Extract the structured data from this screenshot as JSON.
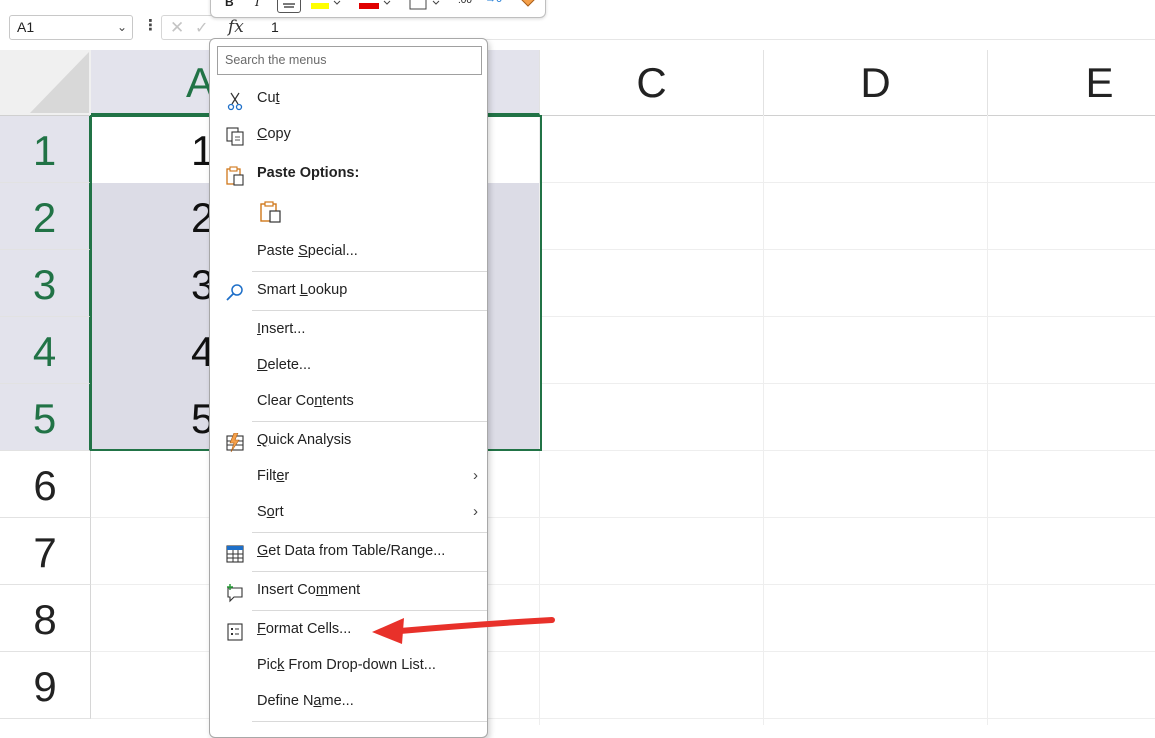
{
  "formula_bar": {
    "name_box": "A1",
    "formula_value": "1",
    "fx_label": "fx"
  },
  "columns": [
    "A",
    "C",
    "D",
    "E"
  ],
  "rows": [
    "1",
    "2",
    "3",
    "4",
    "5",
    "6",
    "7",
    "8",
    "9"
  ],
  "cells_col_a": [
    "1",
    "2",
    "3",
    "4",
    "5"
  ],
  "context_menu": {
    "search_placeholder": "Search the menus",
    "items": {
      "cut": {
        "pre": "Cu",
        "key": "t",
        "post": ""
      },
      "copy": {
        "pre": "",
        "key": "C",
        "post": "opy"
      },
      "paste_options": "Paste Options:",
      "paste_special": {
        "pre": "Paste ",
        "key": "S",
        "post": "pecial..."
      },
      "smart_lookup": {
        "pre": "Smart ",
        "key": "L",
        "post": "ookup"
      },
      "insert": {
        "pre": "",
        "key": "I",
        "post": "nsert..."
      },
      "delete": {
        "pre": "",
        "key": "D",
        "post": "elete..."
      },
      "clear_contents": {
        "pre": "Clear Co",
        "key": "n",
        "post": "tents"
      },
      "quick_analysis": {
        "pre": "",
        "key": "Q",
        "post": "uick Analysis"
      },
      "filter": {
        "pre": "Filt",
        "key": "e",
        "post": "r"
      },
      "sort": {
        "pre": "S",
        "key": "o",
        "post": "rt"
      },
      "get_data": {
        "pre": "",
        "key": "G",
        "post": "et Data from Table/Range..."
      },
      "insert_comment": {
        "pre": "Insert Co",
        "key": "m",
        "post": "ment"
      },
      "format_cells": {
        "pre": "",
        "key": "F",
        "post": "ormat Cells..."
      },
      "pick_list": {
        "pre": "Pic",
        "key": "k",
        "post": " From Drop-down List..."
      },
      "define_name": {
        "pre": "Define N",
        "key": "a",
        "post": "me..."
      }
    }
  },
  "colors": {
    "excel_green": "#217346",
    "selection_fill": "#dcdce6",
    "annotation_red": "#e8312a"
  }
}
